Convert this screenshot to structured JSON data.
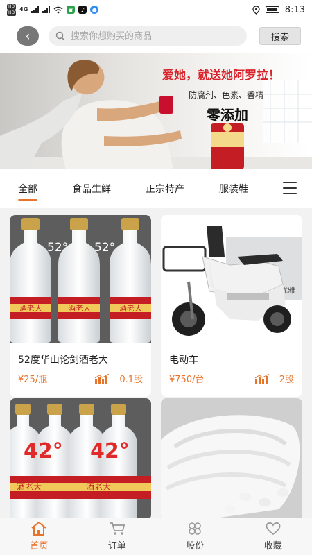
{
  "status_bar": {
    "time": "8:13",
    "network": "4G"
  },
  "header": {
    "search_placeholder": "搜索你想购买的商品",
    "search_button": "搜索"
  },
  "banner": {
    "headline": "爱她，就送她阿罗拉！",
    "subline": "防腐剂、色素、香精",
    "tagline": "零添加"
  },
  "tabs": [
    {
      "label": "全部",
      "active": true
    },
    {
      "label": "食品生鲜",
      "active": false
    },
    {
      "label": "正宗特产",
      "active": false
    },
    {
      "label": "服装鞋",
      "active": false
    }
  ],
  "products": [
    {
      "name": "52度华山论剑酒老大",
      "price": "¥25/瓶",
      "share": "0.1股",
      "image_text": "52°",
      "bottle_label": "酒老大"
    },
    {
      "name": "电动车",
      "price": "¥750/台",
      "share": "2股",
      "image_text": "优雅"
    },
    {
      "name": "",
      "price": "",
      "share": "",
      "image_text": "42°",
      "bottle_label": "酒老大"
    },
    {
      "name": "",
      "price": "",
      "share": "",
      "image_text": ""
    }
  ],
  "bottom_nav": [
    {
      "label": "首页",
      "icon": "home-icon",
      "active": true
    },
    {
      "label": "订单",
      "icon": "cart-icon",
      "active": false
    },
    {
      "label": "股份",
      "icon": "clover-icon",
      "active": false
    },
    {
      "label": "收藏",
      "icon": "heart-icon",
      "active": false
    }
  ],
  "colors": {
    "accent": "#e8732a",
    "banner_red": "#d8232a"
  }
}
